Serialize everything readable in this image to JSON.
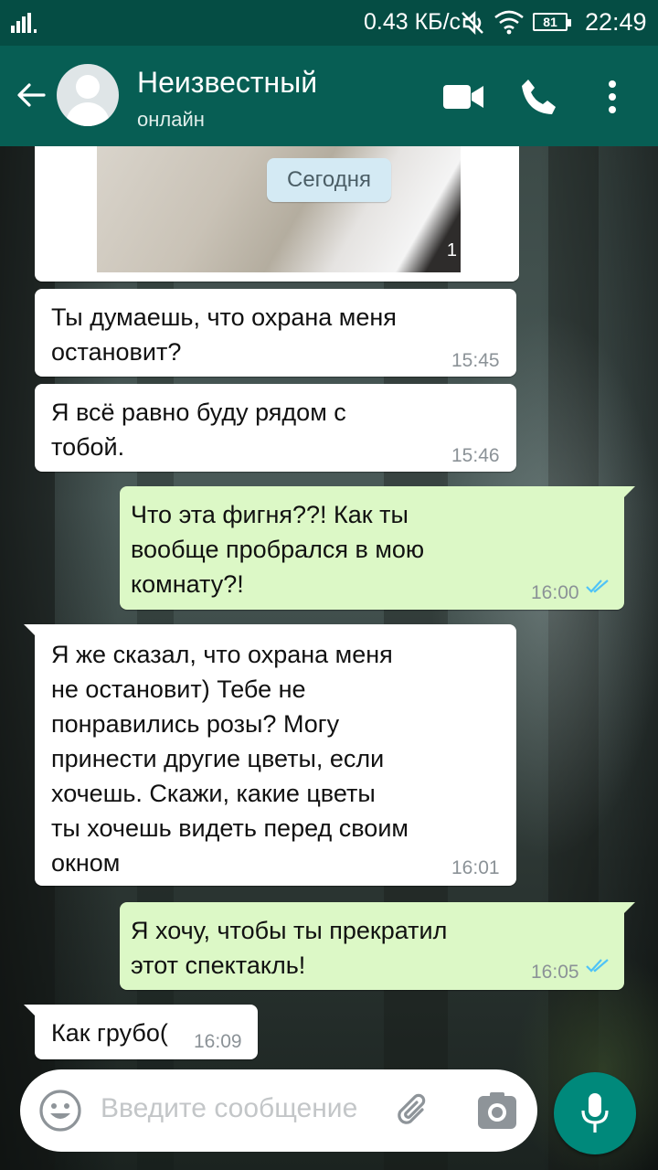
{
  "status_bar": {
    "network_speed": "0.43 КБ/с",
    "battery": "81",
    "time": "22:49"
  },
  "header": {
    "contact_name": "Неизвестный",
    "contact_status": "онлайн",
    "icons": [
      "back-arrow-icon",
      "avatar",
      "video-call-icon",
      "phone-call-icon",
      "more-options-icon"
    ]
  },
  "chat": {
    "date_chip": "Сегодня",
    "image_count": "1",
    "messages": [
      {
        "direction": "in",
        "text": "Ты думаешь, что охрана меня\nостановит?",
        "time": "15:45"
      },
      {
        "direction": "in",
        "text": "Я всё равно буду рядом с\nтобой.",
        "time": "15:46"
      },
      {
        "direction": "out",
        "text": "Что эта фигня??! Как ты\nвообще пробрался в мою\nкомнату?!",
        "time": "16:00",
        "status": "read"
      },
      {
        "direction": "in",
        "text": "Я же сказал, что охрана меня\nне остановит) Тебе не\nпонравились розы? Могу\nпринести другие цветы, если\nхочешь. Скажи, какие цветы\nты хочешь видеть перед своим\nокном",
        "time": "16:01"
      },
      {
        "direction": "out",
        "text": " Я хочу, чтобы ты прекратил\nэтот спектакль!",
        "time": "16:05",
        "status": "read"
      },
      {
        "direction": "in",
        "text": "Как грубо(",
        "time": "16:09"
      }
    ]
  },
  "input_bar": {
    "placeholder": "Введите сообщение",
    "icons": [
      "emoji-icon",
      "attach-icon",
      "camera-icon",
      "microphone-icon"
    ]
  },
  "colors": {
    "header": "#075e54",
    "status_bar": "#054d44",
    "incoming_bubble": "#ffffff",
    "outgoing_bubble": "#dcf8c6",
    "read_ticks": "#4fc3f7",
    "mic_button": "#00897b"
  }
}
